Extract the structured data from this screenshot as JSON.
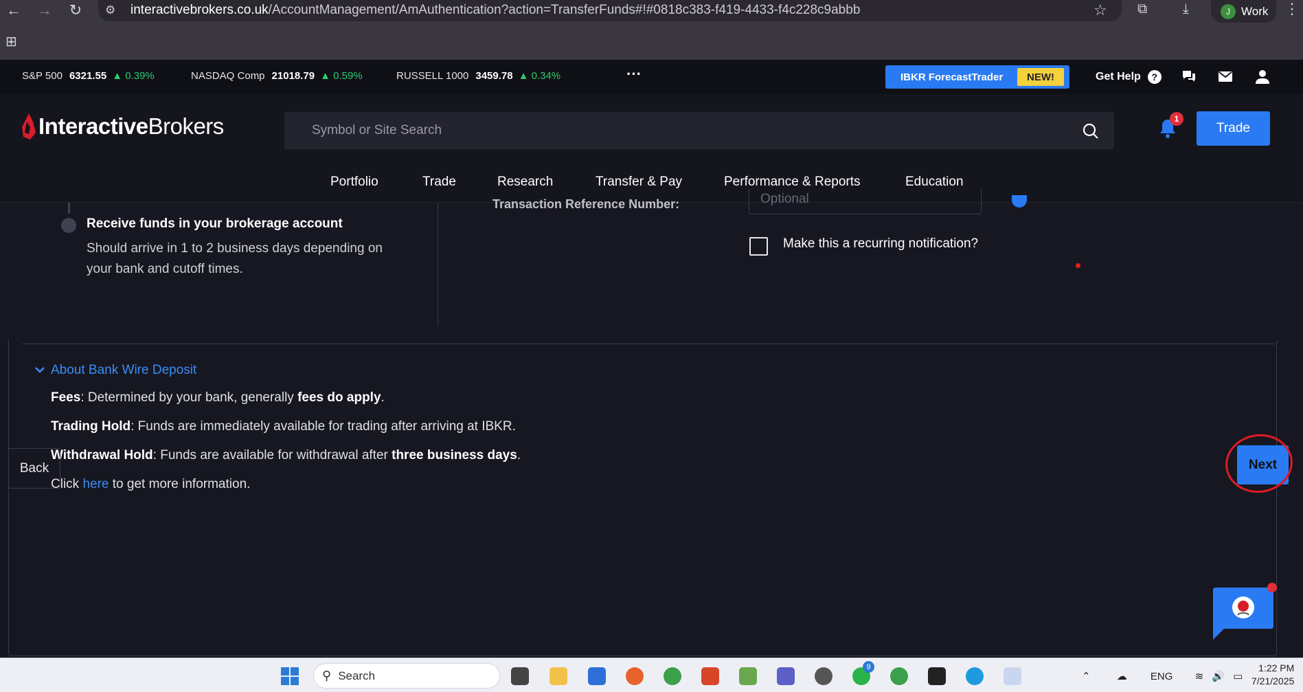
{
  "browser": {
    "url_host": "interactivebrokers.co.uk",
    "url_path": "/AccountManagement/AmAuthentication?action=TransferFunds#!#0818c383-f419-4433-f4c228c9abbb",
    "profile_initial": "J",
    "profile_label": "Work"
  },
  "ticker": [
    {
      "name": "S&P 500",
      "value": "6321.55",
      "change": "0.39%"
    },
    {
      "name": "NASDAQ Comp",
      "value": "21018.79",
      "change": "0.59%"
    },
    {
      "name": "RUSSELL 1000",
      "value": "3459.78",
      "change": "0.34%"
    }
  ],
  "topbar": {
    "forecast_label": "IBKR ForecastTrader",
    "new_badge": "NEW!",
    "get_help": "Get Help",
    "help_symbol": "?"
  },
  "header": {
    "logo_bold": "Interactive",
    "logo_light": "Brokers",
    "search_placeholder": "Symbol or Site Search",
    "notification_count": "1",
    "trade_label": "Trade"
  },
  "menu": [
    "Portfolio",
    "Trade",
    "Research",
    "Transfer & Pay",
    "Performance & Reports",
    "Education"
  ],
  "step": {
    "title": "Receive funds in your brokerage account",
    "description": "Should arrive in 1 to 2 business days depending on your bank and cutoff times."
  },
  "form": {
    "reference_label": "Transaction Reference Number:",
    "reference_placeholder": "Optional",
    "recurring_label": "Make this a recurring notification?"
  },
  "about": {
    "toggle_label": "About Bank Wire Deposit",
    "fees_label": "Fees",
    "fees_text": ": Determined by your bank, generally ",
    "fees_bold": "fees do apply",
    "trading_label": "Trading Hold",
    "trading_text": ": Funds are immediately available for trading after arriving at IBKR.",
    "withdrawal_label": "Withdrawal Hold",
    "withdrawal_text": ": Funds are available for withdrawal after ",
    "withdrawal_bold": "three business days",
    "click_prefix": "Click ",
    "click_link": "here",
    "click_suffix": " to get more information."
  },
  "actions": {
    "back_label": "Back",
    "next_label": "Next"
  },
  "taskbar": {
    "search_label": "Search",
    "lang": "ENG",
    "time": "1:22 PM",
    "date": "7/21/2025",
    "whatsapp_badge": "9"
  },
  "colors": {
    "accent": "#2a7af3",
    "positive": "#2ecc71",
    "badge_yellow": "#f5d13b",
    "annotation_red": "#e01b24"
  }
}
